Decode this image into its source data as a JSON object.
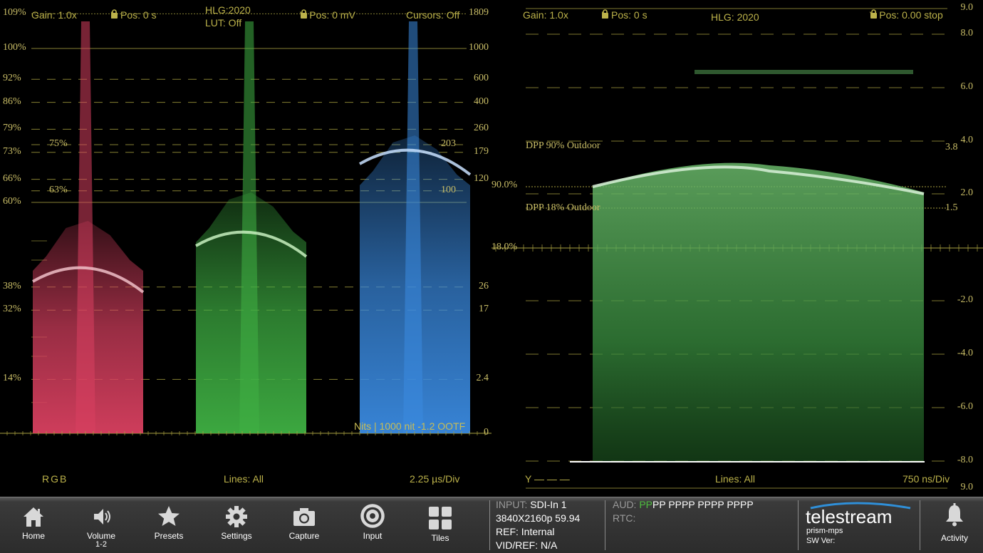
{
  "left_scope": {
    "gain": "Gain: 1.0x",
    "hpos": "H Pos: 0 s",
    "hlg": "HLG:2020",
    "lut": "LUT: Off",
    "vpos": "V Pos: 0 mV",
    "cursors": "Cursors: Off",
    "left_axis": [
      {
        "label": "109%",
        "level": 109
      },
      {
        "label": "100%",
        "level": 100
      },
      {
        "label": "92%",
        "level": 92
      },
      {
        "label": "86%",
        "level": 86
      },
      {
        "label": "79%",
        "level": 79
      },
      {
        "label": "73%",
        "level": 73
      },
      {
        "label": "66%",
        "level": 66
      },
      {
        "label": "60%",
        "level": 60
      },
      {
        "label": "38%",
        "level": 38
      },
      {
        "label": "32%",
        "level": 32
      },
      {
        "label": "14%",
        "level": 14
      }
    ],
    "inner_labels": [
      {
        "label": "75%",
        "level": 75
      },
      {
        "label": "63%",
        "level": 63
      }
    ],
    "right_axis": [
      {
        "label": "1809",
        "level": 109
      },
      {
        "label": "1000",
        "level": 100
      },
      {
        "label": "600",
        "level": 92
      },
      {
        "label": "400",
        "level": 86
      },
      {
        "label": "260",
        "level": 79
      },
      {
        "label": "179",
        "level": 73
      },
      {
        "label": "120",
        "level": 66
      },
      {
        "label": "26",
        "level": 38
      },
      {
        "label": "17",
        "level": 32
      },
      {
        "label": "2.4",
        "level": 14
      },
      {
        "label": "0",
        "level": 0
      }
    ],
    "inner_right": [
      {
        "label": "203",
        "level": 75
      },
      {
        "label": "100",
        "level": 63
      }
    ],
    "nits_label": "Nits | 1000 nit -1.2 OOTF",
    "footer_mode": "RGB",
    "footer_lines": "Lines: All",
    "footer_time": "2.25 µs/Div"
  },
  "right_scope": {
    "gain": "Gain: 1.0x",
    "hpos": "H Pos: 0 s",
    "hlg": "HLG: 2020",
    "vpos": "V Pos: 0.00 stop",
    "stop_axis": [
      "9.0",
      "8.0",
      "6.0",
      "4.0",
      "2.0",
      "-2.0",
      "-4.0",
      "-6.0",
      "-8.0",
      "9.0"
    ],
    "dpp90": "DPP 90% Outdoor",
    "dpp18": "DPP 18% Outdoor",
    "val_90": "90.0%",
    "val_18": "18.0%",
    "val_38": "3.8",
    "val_15": "1.5",
    "footer_y": "Y — — —",
    "footer_lines": "Lines: All",
    "footer_time": "750 ns/Div"
  },
  "toolbar": {
    "buttons": [
      {
        "label": "Home",
        "icon": "home-icon"
      },
      {
        "label": "Volume",
        "sub": "1-2",
        "icon": "speaker-icon"
      },
      {
        "label": "Presets",
        "icon": "star-icon"
      },
      {
        "label": "Settings",
        "icon": "gear-icon"
      },
      {
        "label": "Capture",
        "icon": "camera-icon"
      },
      {
        "label": "Input",
        "icon": "input-icon"
      },
      {
        "label": "Tiles",
        "icon": "tiles-icon"
      }
    ],
    "input_key": "INPUT:",
    "input_val": "SDI-In 1",
    "format": "3840X2160p 59.94",
    "ref_key": "REF:",
    "ref_val": "Internal",
    "vidref_key": "VID/REF:",
    "vidref_val": "N/A",
    "aud_key": "AUD:",
    "aud_green": "PP",
    "aud_rest": "PP PPPP PPPP PPPP",
    "rtc_key": "RTC:",
    "brand": "telestream",
    "product": "prism-mps",
    "sw_ver": "SW Ver:",
    "activity": "Activity",
    "colors": {
      "red": "#d94060",
      "green": "#3fb043",
      "blue": "#3a8ae0",
      "graticule": "#a8a040",
      "accent_blue": "#2f8fd8"
    }
  }
}
